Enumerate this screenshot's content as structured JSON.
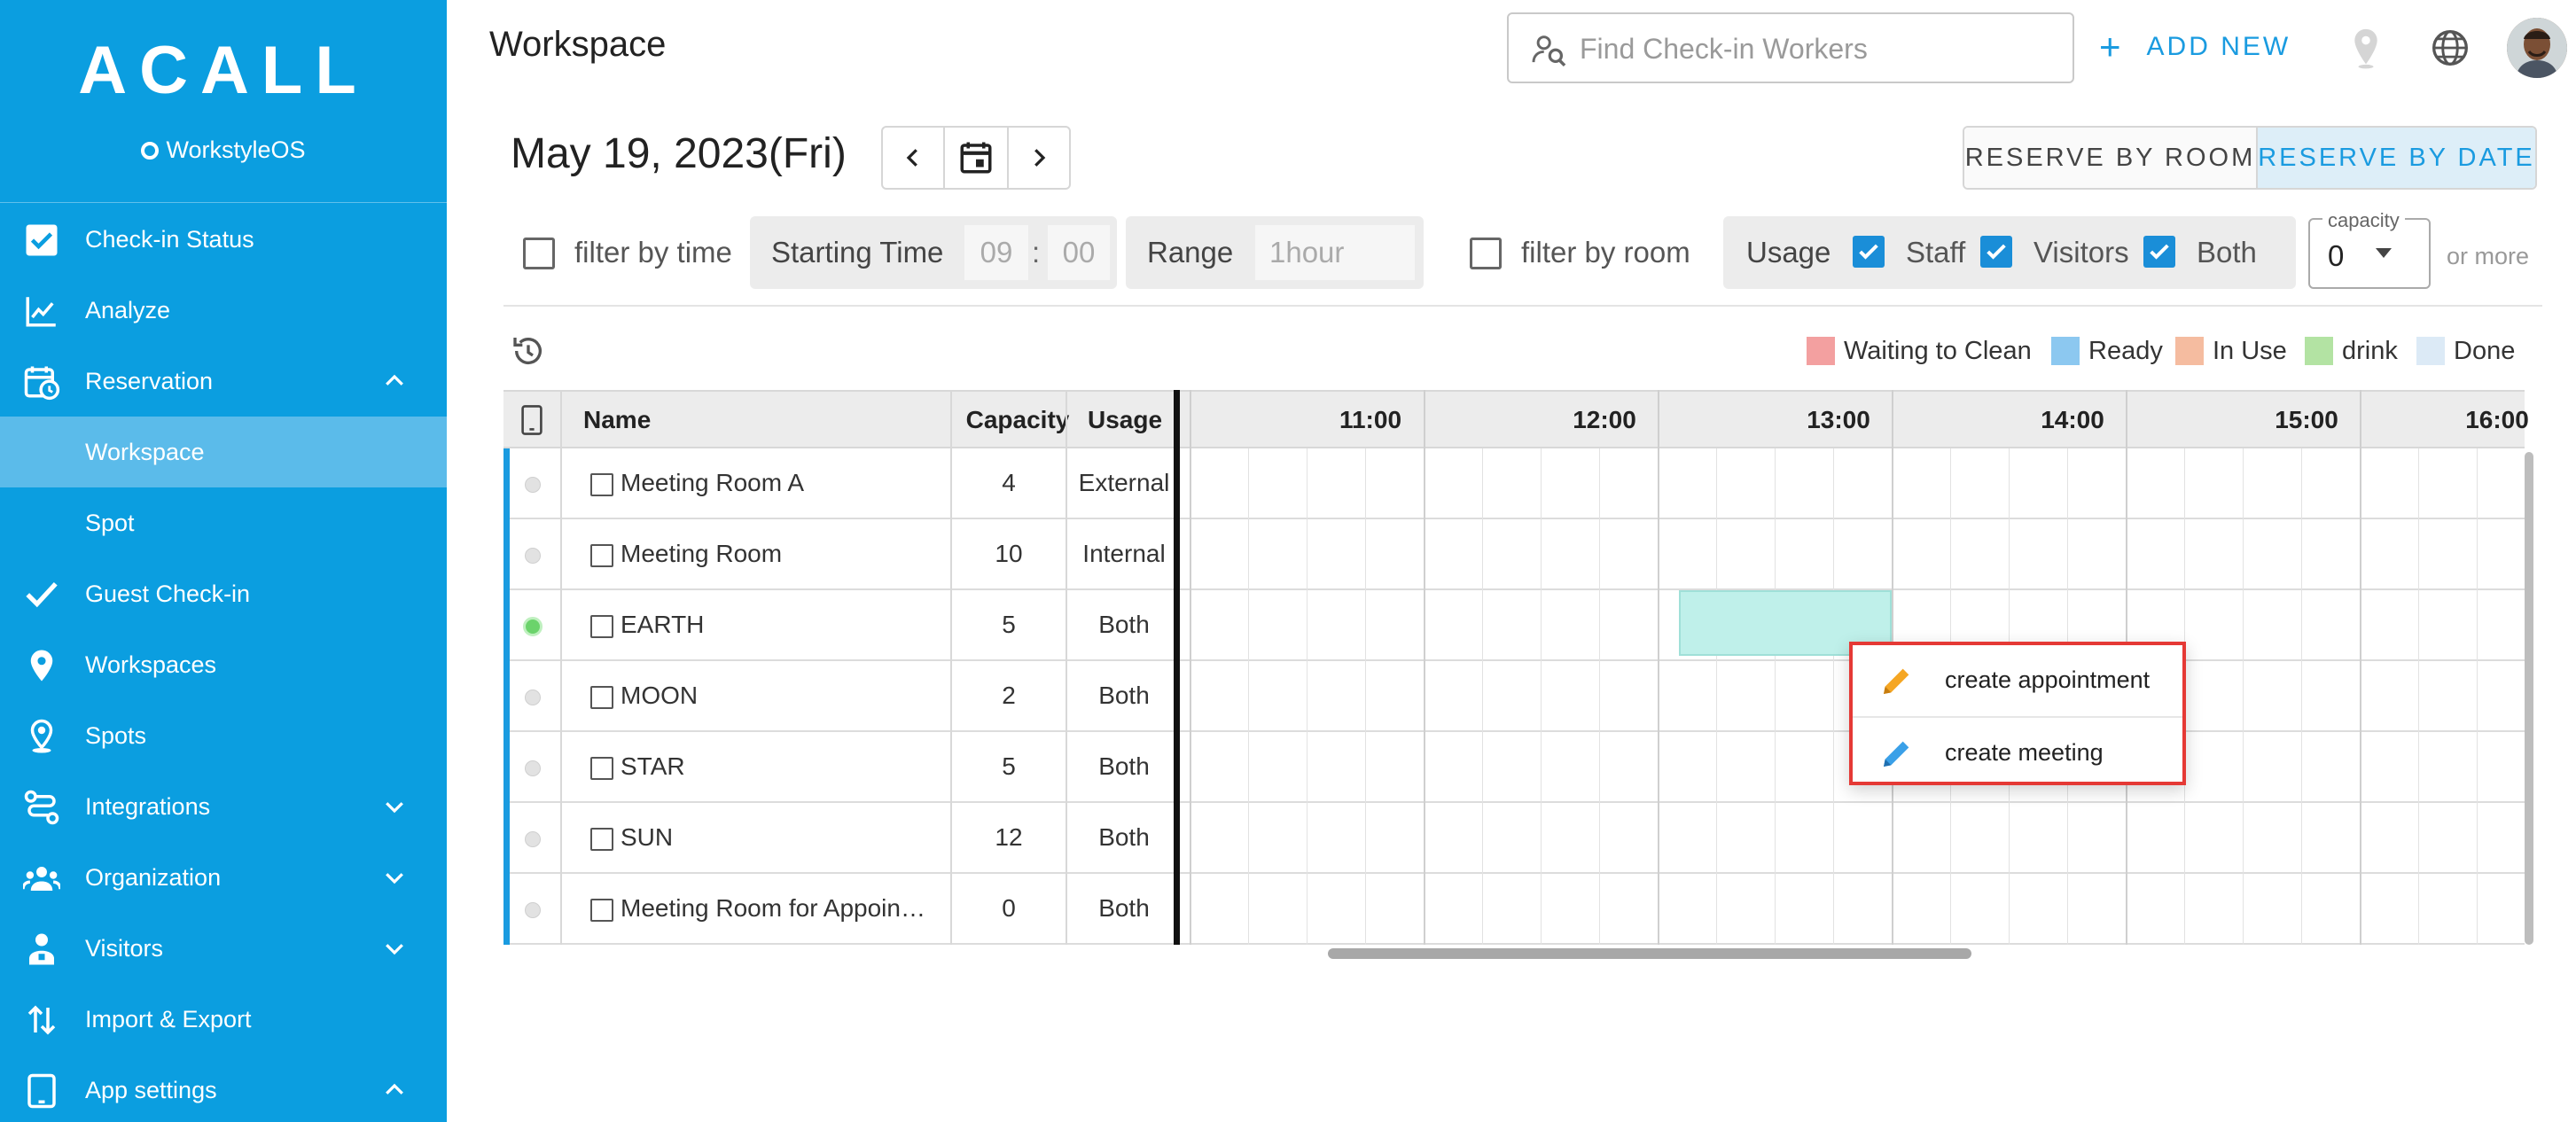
{
  "sidebar": {
    "logo": "ACALL",
    "logo_sub": "WorkstyleOS",
    "items": [
      {
        "label": "Check-in Status",
        "icon": "check-box-icon"
      },
      {
        "label": "Analyze",
        "icon": "line-chart-icon"
      },
      {
        "label": "Reservation",
        "icon": "calendar-clock-icon",
        "chevron": "up"
      },
      {
        "label": "Workspace",
        "active": true
      },
      {
        "label": "Spot"
      },
      {
        "label": "Guest Check-in",
        "icon": "check-mark-icon"
      },
      {
        "label": "Workspaces",
        "icon": "map-pin-icon"
      },
      {
        "label": "Spots",
        "icon": "person-pin-icon"
      },
      {
        "label": "Integrations",
        "icon": "integration-icon",
        "chevron": "down"
      },
      {
        "label": "Organization",
        "icon": "people-icon",
        "chevron": "down"
      },
      {
        "label": "Visitors",
        "icon": "visitor-icon",
        "chevron": "down"
      },
      {
        "label": "Import & Export",
        "icon": "import-export-icon"
      },
      {
        "label": "App settings",
        "icon": "tablet-icon",
        "chevron": "up"
      }
    ]
  },
  "header": {
    "title": "Workspace",
    "search_placeholder": "Find Check-in Workers",
    "add_new_icon": "+",
    "add_new_label": "ADD NEW"
  },
  "date_nav": {
    "date": "May 19, 2023(Fri)"
  },
  "reserve": {
    "by_room": "RESERVE BY ROOM",
    "by_date": "RESERVE BY DATE",
    "selected": "by_date"
  },
  "filters": {
    "filter_by_time": "filter by time",
    "starting_time_label": "Starting Time",
    "hour": "09",
    "colon": ":",
    "minute": "00",
    "range_label": "Range",
    "range_value": "1hour",
    "filter_by_room": "filter by room",
    "usage_label": "Usage",
    "staff": "Staff",
    "visitors": "Visitors",
    "both": "Both",
    "capacity_label": "capacity",
    "capacity_value": "0",
    "or_more": "or more"
  },
  "legend": [
    {
      "label": "Waiting to Clean",
      "color": "#f3a0a0"
    },
    {
      "label": "Ready",
      "color": "#8cc8f0"
    },
    {
      "label": "In Use",
      "color": "#f5bca0"
    },
    {
      "label": "drink",
      "color": "#b3e3a3"
    },
    {
      "label": "Done",
      "color": "#dceaf6"
    }
  ],
  "table": {
    "headers": {
      "name": "Name",
      "capacity": "Capacity",
      "usage": "Usage"
    },
    "times": [
      "11:00",
      "12:00",
      "13:00",
      "14:00",
      "15:00",
      "16:00"
    ],
    "rows": [
      {
        "name": "Meeting Room A",
        "capacity": "4",
        "usage": "External",
        "active": false
      },
      {
        "name": "Meeting Room",
        "capacity": "10",
        "usage": "Internal",
        "active": false
      },
      {
        "name": "EARTH",
        "capacity": "5",
        "usage": "Both",
        "active": true
      },
      {
        "name": "MOON",
        "capacity": "2",
        "usage": "Both",
        "active": false
      },
      {
        "name": "STAR",
        "capacity": "5",
        "usage": "Both",
        "active": false
      },
      {
        "name": "SUN",
        "capacity": "12",
        "usage": "Both",
        "active": false
      },
      {
        "name": "Meeting Room for Appoin…",
        "capacity": "0",
        "usage": "Both",
        "active": false
      }
    ]
  },
  "context_menu": {
    "create_appointment": "create appointment",
    "create_meeting": "create meeting",
    "appointment_icon_color": "#f5a623",
    "meeting_icon_color": "#3aa0e8"
  }
}
